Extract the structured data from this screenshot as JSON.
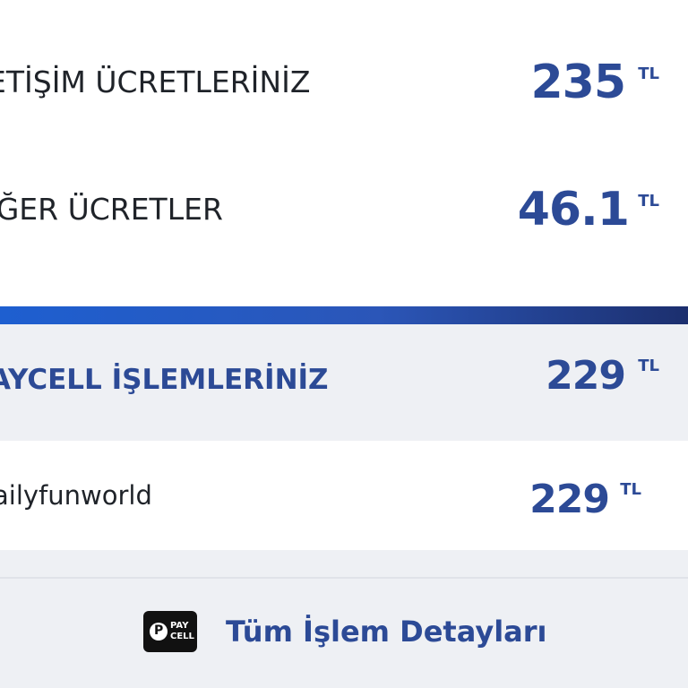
{
  "charges": {
    "communication": {
      "label": "ETİŞİM ÜCRETLERİNİZ",
      "amount": "235",
      "unit": "TL"
    },
    "other": {
      "label": "İĞER ÜCRETLER",
      "amount": "46.1",
      "unit": "TL"
    }
  },
  "paycell": {
    "label": "AYCELL İŞLEMLERİNİZ",
    "amount": "229",
    "unit": "TL",
    "items": [
      {
        "label": "ailyfunworld",
        "amount": "229",
        "unit": "TL"
      }
    ]
  },
  "cta": {
    "logo_text_top": "PAY",
    "logo_text_bottom": "CELL",
    "label": "Tüm İşlem Detayları"
  },
  "colors": {
    "accent": "#2c4a96",
    "bar_start": "#1e5fd0",
    "bar_end": "#1c2f6e",
    "section_bg": "#eef0f4"
  }
}
